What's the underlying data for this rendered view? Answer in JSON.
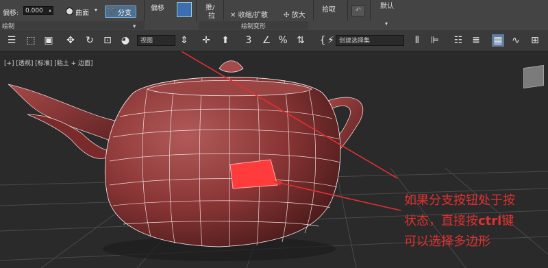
{
  "ribbon": {
    "offset_label": "偏移:",
    "offset_value": "0.000",
    "surface_label": "曲面",
    "branch_label": "分支",
    "draw_section": "绘制",
    "offset_btn": "偏移",
    "push_line1": "推/",
    "push_line2": "拉",
    "shrink_expand": "收缩/扩散",
    "enlarge": "放大",
    "deform_section": "绘制变形",
    "pick": "拾取",
    "default": "默认"
  },
  "toolbar": {
    "view_select": "视图",
    "selection_set": "创建选择集"
  },
  "viewport": {
    "label_views": "[+] [透视] [标准] [粘土 + 边面]"
  },
  "annotation": {
    "line1": "如果分支按钮处于按",
    "line2_prefix": "状态，直接按",
    "line2_key": "ctrl",
    "line2_suffix": "键",
    "line3": "可以选择多边形"
  },
  "colors": {
    "annotation": "#e23030",
    "teapot": "#8a3535",
    "selected_poly": "#ff3b3b"
  }
}
